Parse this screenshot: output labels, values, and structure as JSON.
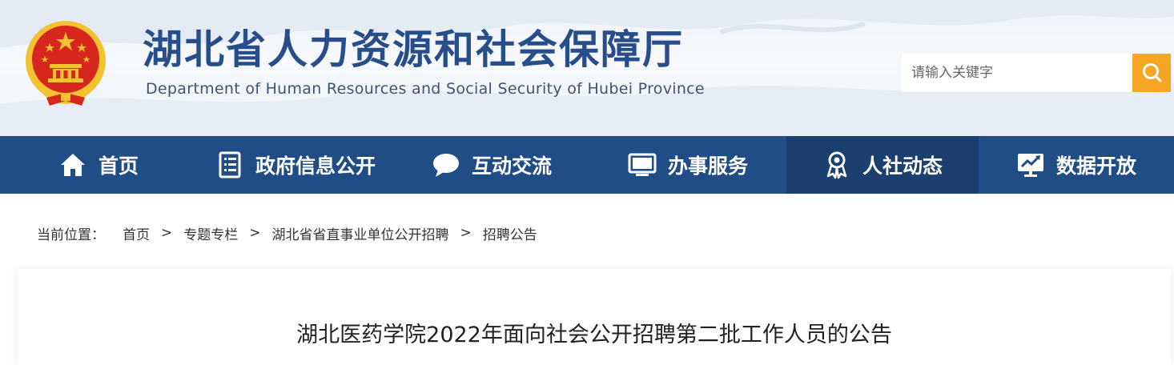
{
  "header": {
    "site_title": "湖北省人力资源和社会保障厅",
    "site_subtitle": "Department of Human Resources and Social Security of Hubei Province",
    "search": {
      "placeholder": "请输入关键字"
    }
  },
  "nav": {
    "items": [
      {
        "label": "首页",
        "icon": "home-icon"
      },
      {
        "label": "政府信息公开",
        "icon": "document-list-icon"
      },
      {
        "label": "互动交流",
        "icon": "chat-bubble-icon"
      },
      {
        "label": "办事服务",
        "icon": "monitor-icon"
      },
      {
        "label": "人社动态",
        "icon": "person-badge-icon",
        "active": true
      },
      {
        "label": "数据开放",
        "icon": "chart-screen-icon"
      }
    ]
  },
  "breadcrumb": {
    "prefix": "当前位置：",
    "items": [
      "首页",
      "专题专栏",
      "湖北省省直事业单位公开招聘",
      "招聘公告"
    ],
    "separator": ">"
  },
  "article": {
    "title": "湖北医药学院2022年面向社会公开招聘第二批工作人员的公告"
  },
  "colors": {
    "nav_background": "#214d86",
    "nav_active": "#1b3f6e",
    "title_blue": "#274e8a",
    "search_button": "#f6a623",
    "emblem_red": "#d7261e",
    "emblem_gold": "#f2c230"
  }
}
